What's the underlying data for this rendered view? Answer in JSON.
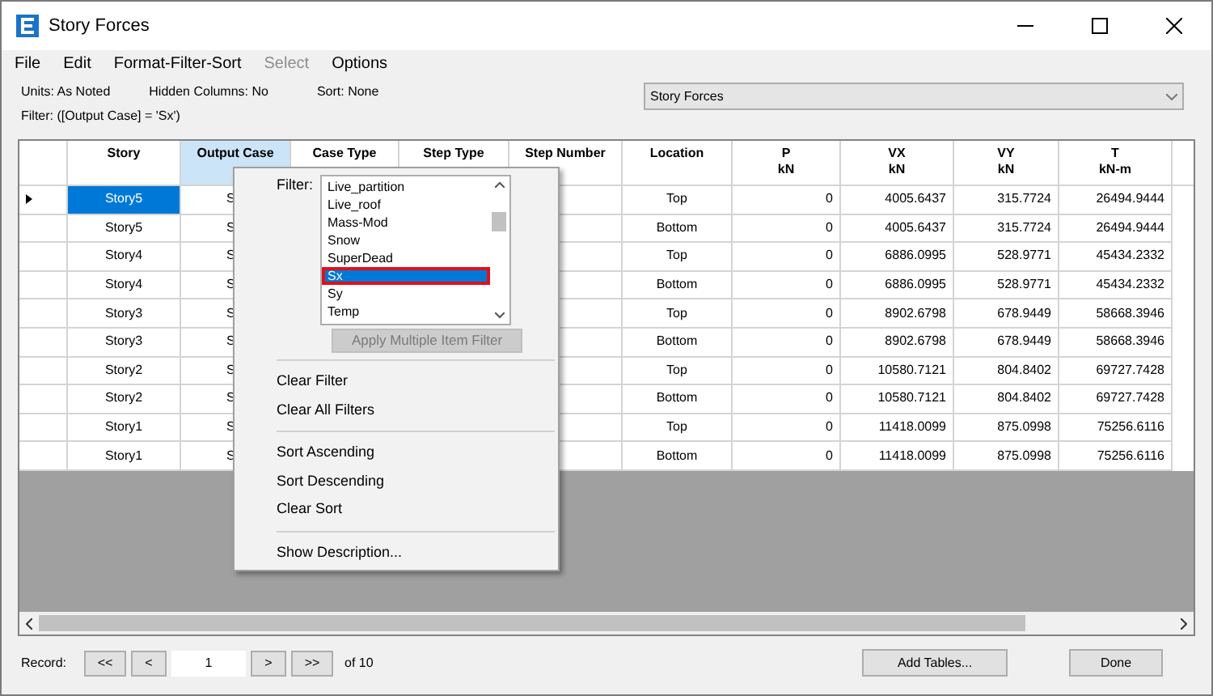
{
  "window": {
    "title": "Story Forces"
  },
  "menu": [
    {
      "label": "File",
      "disabled": false
    },
    {
      "label": "Edit",
      "disabled": false
    },
    {
      "label": "Format-Filter-Sort",
      "disabled": false
    },
    {
      "label": "Select",
      "disabled": true
    },
    {
      "label": "Options",
      "disabled": false
    }
  ],
  "info": {
    "units": "Units:  As Noted",
    "hidden": "Hidden Columns:  No",
    "sort": "Sort:  None",
    "filter": "Filter:  ([Output Case] = 'Sx')"
  },
  "table_select": {
    "value": "Story Forces"
  },
  "table": {
    "columns": [
      {
        "name": "Story"
      },
      {
        "name": "Output Case"
      },
      {
        "name": "Case Type"
      },
      {
        "name": "Step Type"
      },
      {
        "name": "Step Number"
      },
      {
        "name": "Location"
      },
      {
        "name": "P",
        "unit": "kN"
      },
      {
        "name": "VX",
        "unit": "kN"
      },
      {
        "name": "VY",
        "unit": "kN"
      },
      {
        "name": "T",
        "unit": "kN-m"
      }
    ],
    "rows": [
      {
        "current": true,
        "story": "Story5",
        "case": "S",
        "location": "Top",
        "p": "0",
        "vx": "4005.6437",
        "vy": "315.7724",
        "t": "26494.9444"
      },
      {
        "current": false,
        "story": "Story5",
        "case": "S",
        "location": "Bottom",
        "p": "0",
        "vx": "4005.6437",
        "vy": "315.7724",
        "t": "26494.9444"
      },
      {
        "current": false,
        "story": "Story4",
        "case": "S",
        "location": "Top",
        "p": "0",
        "vx": "6886.0995",
        "vy": "528.9771",
        "t": "45434.2332"
      },
      {
        "current": false,
        "story": "Story4",
        "case": "S",
        "location": "Bottom",
        "p": "0",
        "vx": "6886.0995",
        "vy": "528.9771",
        "t": "45434.2332"
      },
      {
        "current": false,
        "story": "Story3",
        "case": "S",
        "location": "Top",
        "p": "0",
        "vx": "8902.6798",
        "vy": "678.9449",
        "t": "58668.3946"
      },
      {
        "current": false,
        "story": "Story3",
        "case": "S",
        "location": "Bottom",
        "p": "0",
        "vx": "8902.6798",
        "vy": "678.9449",
        "t": "58668.3946"
      },
      {
        "current": false,
        "story": "Story2",
        "case": "S",
        "location": "Top",
        "p": "0",
        "vx": "10580.7121",
        "vy": "804.8402",
        "t": "69727.7428"
      },
      {
        "current": false,
        "story": "Story2",
        "case": "S",
        "location": "Bottom",
        "p": "0",
        "vx": "10580.7121",
        "vy": "804.8402",
        "t": "69727.7428"
      },
      {
        "current": false,
        "story": "Story1",
        "case": "S",
        "location": "Top",
        "p": "0",
        "vx": "11418.0099",
        "vy": "875.0998",
        "t": "75256.6116"
      },
      {
        "current": false,
        "story": "Story1",
        "case": "S",
        "location": "Bottom",
        "p": "0",
        "vx": "11418.0099",
        "vy": "875.0998",
        "t": "75256.6116"
      }
    ]
  },
  "popup": {
    "filter_label": "Filter:",
    "options": [
      {
        "label": "Live_partition",
        "selected": false
      },
      {
        "label": "Live_roof",
        "selected": false
      },
      {
        "label": "Mass-Mod",
        "selected": false
      },
      {
        "label": "Snow",
        "selected": false
      },
      {
        "label": "SuperDead",
        "selected": false
      },
      {
        "label": "Sx",
        "selected": true
      },
      {
        "label": "Sy",
        "selected": false
      },
      {
        "label": "Temp",
        "selected": false
      }
    ],
    "apply_button": {
      "label": "Apply Multiple Item Filter",
      "disabled": true
    },
    "groups": [
      [
        "Clear Filter",
        "Clear All Filters"
      ],
      [
        "Sort Ascending",
        "Sort Descending",
        "Clear Sort"
      ],
      [
        "Show Description..."
      ]
    ]
  },
  "footer": {
    "record_label": "Record:",
    "first": "<<",
    "prev": "<",
    "record": "1",
    "next": ">",
    "last": ">>",
    "of": "of 10",
    "add_tables": "Add Tables...",
    "done": "Done"
  }
}
